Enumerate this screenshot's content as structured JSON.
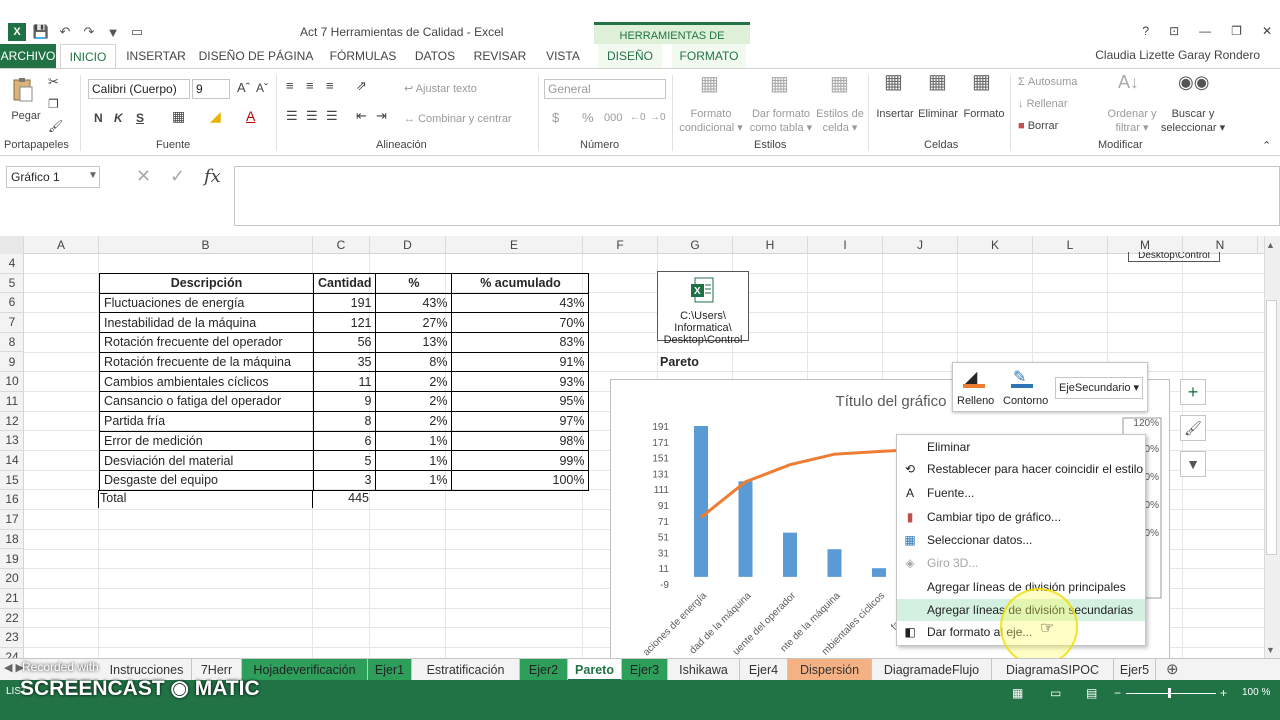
{
  "window": {
    "title": "Act 7 Herramientas de Calidad - Excel",
    "context_group": "HERRAMIENTAS DE GRÁFICOS",
    "user": "Claudia Lizette Garay Rondero",
    "controls": [
      "?",
      "⊡",
      "—",
      "❐",
      "✕"
    ]
  },
  "ribbon_tabs": [
    "ARCHIVO",
    "INICIO",
    "INSERTAR",
    "DISEÑO DE PÁGINA",
    "FÓRMULAS",
    "DATOS",
    "REVISAR",
    "VISTA",
    "DISEÑO",
    "FORMATO"
  ],
  "ribbon": {
    "pegar": "Pegar",
    "font_name": "Calibri (Cuerpo)",
    "font_size": "9",
    "bold": "N",
    "italic": "K",
    "underline": "S",
    "ajustar_texto": "Ajustar texto",
    "combinar": "Combinar y centrar",
    "number_format": "General",
    "formato_condicional": [
      "Formato",
      "condicional ▾"
    ],
    "dar_formato_tabla": [
      "Dar formato",
      "como tabla ▾"
    ],
    "estilos_celda": [
      "Estilos de",
      "celda ▾"
    ],
    "insertar": "Insertar",
    "eliminar": "Eliminar",
    "formato": "Formato",
    "autosuma": "Autosuma",
    "rellenar": "Rellenar",
    "borrar": "Borrar",
    "ordenar": [
      "Ordenar y",
      "filtrar ▾"
    ],
    "buscar": [
      "Buscar y",
      "seleccionar ▾"
    ],
    "groups": [
      "Portapapeles",
      "Fuente",
      "Alineación",
      "Número",
      "Estilos",
      "Celdas",
      "Modificar"
    ]
  },
  "formula_bar": {
    "name_box": "Gráfico 1",
    "fx": "fx",
    "content": ""
  },
  "columns": [
    "A",
    "B",
    "C",
    "D",
    "E",
    "F",
    "G",
    "H",
    "I",
    "J",
    "K",
    "L",
    "M",
    "N"
  ],
  "rows": [
    "4",
    "5",
    "6",
    "7",
    "8",
    "9",
    "10",
    "11",
    "12",
    "13",
    "14",
    "15",
    "16",
    "17",
    "18",
    "19",
    "20",
    "21",
    "22",
    "23",
    "24"
  ],
  "table": {
    "headers": [
      "Descripción",
      "Cantidad",
      "%",
      "% acumulado"
    ],
    "rows": [
      [
        "Fluctuaciones de energía",
        "191",
        "43%",
        "43%"
      ],
      [
        "Inestabilidad de la máquina",
        "121",
        "27%",
        "70%"
      ],
      [
        "Rotación frecuente del operador",
        "56",
        "13%",
        "83%"
      ],
      [
        "Rotación frecuente de la máquina",
        "35",
        "8%",
        "91%"
      ],
      [
        "Cambios ambientales cíclicos",
        "11",
        "2%",
        "93%"
      ],
      [
        "Cansancio o fatiga del operador",
        "9",
        "2%",
        "95%"
      ],
      [
        "Partida fría",
        "8",
        "2%",
        "97%"
      ],
      [
        "Error de medición",
        "6",
        "1%",
        "98%"
      ],
      [
        "Desviación del material",
        "5",
        "1%",
        "99%"
      ],
      [
        "Desgaste del equipo",
        "3",
        "1%",
        "100%"
      ]
    ],
    "total_label": "Total",
    "total_value": "445"
  },
  "embedded_object": {
    "lines": [
      "C:\\Users\\",
      "Informatica\\",
      "Desktop\\Control"
    ],
    "second": "Desktop\\Control"
  },
  "pareto_label": "Pareto",
  "chart_data": {
    "type": "bar",
    "title": "Título del gráfico",
    "categories": [
      "Fluctuaciones de energía",
      "Inestabilidad de la máquina",
      "Rotación frecuente del operador",
      "Rotación frecuente de la máquina",
      "Cambios ambientales cíclicos",
      "Cansancio o fatiga del operador"
    ],
    "category_labels_visible": [
      "aciones de energía",
      "dad de la máquina",
      "uente del operador",
      "nte de la máquina",
      "mbientales cíclicos",
      "fatiga del o"
    ],
    "series": [
      {
        "name": "Cantidad",
        "type": "bar",
        "values": [
          191,
          121,
          56,
          35,
          11,
          9
        ]
      },
      {
        "name": "% acumulado",
        "type": "line",
        "values": [
          43,
          70,
          83,
          91,
          93,
          95
        ]
      }
    ],
    "y_ticks": [
      "191",
      "171",
      "151",
      "131",
      "111",
      "91",
      "71",
      "51",
      "31",
      "11",
      "-9"
    ],
    "ylim": [
      -9,
      191
    ],
    "y2_ticks": [
      "120%",
      "0%",
      "0%",
      "0%",
      "0%"
    ],
    "colors": {
      "bars": "#5b9bd5",
      "line": "#ed7d31"
    }
  },
  "mini_toolbar": {
    "fill": "Relleno",
    "outline": "Contorno",
    "selector": "EjeSecundario"
  },
  "context_menu": [
    {
      "label": "Eliminar",
      "icon": "",
      "enabled": true
    },
    {
      "label": "Restablecer para hacer coincidir el estilo",
      "icon": "reset-icon",
      "enabled": true
    },
    {
      "label": "Fuente...",
      "icon": "font-icon",
      "enabled": true
    },
    {
      "label": "Cambiar tipo de gráfico...",
      "icon": "chart-type-icon",
      "enabled": true
    },
    {
      "label": "Seleccionar datos...",
      "icon": "select-data-icon",
      "enabled": true
    },
    {
      "label": "Giro 3D...",
      "icon": "rotation-icon",
      "enabled": false
    },
    {
      "label": "Agregar líneas de división principales",
      "icon": "",
      "enabled": true
    },
    {
      "label": "Agregar líneas de división secundarias",
      "icon": "",
      "enabled": true,
      "highlighted": true
    },
    {
      "label": "Dar formato al eje...",
      "icon": "format-axis-icon",
      "enabled": true
    }
  ],
  "sheet_tabs": [
    {
      "label": "Instrucciones",
      "style": "normal"
    },
    {
      "label": "7Herr",
      "style": "normal"
    },
    {
      "label": "Hojadeverificación",
      "style": "green"
    },
    {
      "label": "Ejer1",
      "style": "green"
    },
    {
      "label": "Estratificación",
      "style": "normal"
    },
    {
      "label": "Ejer2",
      "style": "green"
    },
    {
      "label": "Pareto",
      "style": "active"
    },
    {
      "label": "Ejer3",
      "style": "green"
    },
    {
      "label": "Ishikawa",
      "style": "normal"
    },
    {
      "label": "Ejer4",
      "style": "normal"
    },
    {
      "label": "Dispersión",
      "style": "orange"
    },
    {
      "label": "DiagramadeFlujo",
      "style": "normal"
    },
    {
      "label": "DiagramaSIPOC",
      "style": "normal"
    },
    {
      "label": "Ejer5",
      "style": "normal"
    }
  ],
  "status": {
    "left": "LIST",
    "zoom": "100 %",
    "watermark": "SCREENCAST",
    "watermark2": "MATIC",
    "recorded": "Recorded with"
  }
}
